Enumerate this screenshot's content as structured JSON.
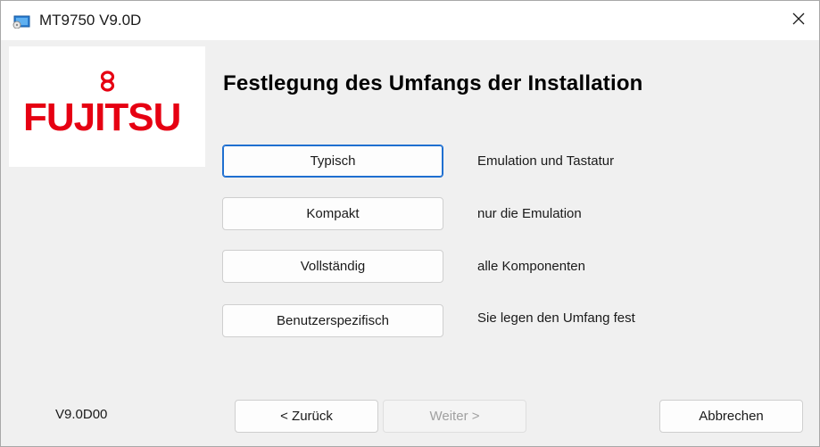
{
  "window": {
    "title": "MT9750 V9.0D"
  },
  "sidebar": {
    "logo_text": "FUJITSU",
    "version": "V9.0D00"
  },
  "main": {
    "heading": "Festlegung des Umfangs der Installation",
    "options": [
      {
        "label": "Typisch",
        "description": "Emulation und Tastatur",
        "is_default": true
      },
      {
        "label": "Kompakt",
        "description": "nur die Emulation",
        "is_default": false
      },
      {
        "label": "Vollständig",
        "description": "alle Komponenten",
        "is_default": false
      },
      {
        "label": "Benutzerspezifisch",
        "description": "Sie legen den Umfang fest",
        "is_default": false
      }
    ]
  },
  "footer": {
    "back_label": "< Zurück",
    "next_label": "Weiter >",
    "next_enabled": false,
    "cancel_label": "Abbrechen"
  },
  "colors": {
    "brand_red": "#e60012",
    "focus_blue": "#1f6fd0",
    "panel_bg": "#f0f0f0"
  },
  "icons": {
    "app": "installer-app-icon",
    "close": "close-icon"
  }
}
